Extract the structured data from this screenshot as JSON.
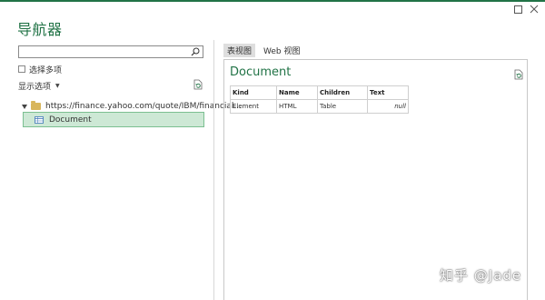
{
  "window": {
    "title": "导航器"
  },
  "left_panel": {
    "search": {
      "placeholder": "",
      "value": ""
    },
    "select_multiple_label": "选择多项",
    "display_options_label": "显示选项",
    "tree": {
      "root_url": "https://finance.yahoo.com/quote/IBM/financial...",
      "selected_item": "Document"
    }
  },
  "tabs": [
    {
      "label": "表视图",
      "active": true
    },
    {
      "label": "Web 视图",
      "active": false
    }
  ],
  "preview": {
    "title": "Document",
    "columns": [
      "Kind",
      "Name",
      "Children",
      "Text"
    ],
    "rows": [
      [
        "Element",
        "HTML",
        "Table",
        "null"
      ]
    ]
  },
  "watermark": "知乎 @Jade",
  "colors": {
    "accent": "#217346",
    "selection_bg": "#cde8d5"
  },
  "icons": [
    "maximize-icon",
    "close-icon",
    "search-icon",
    "checkbox-icon",
    "chevron-down-icon",
    "refresh-icon",
    "expand-arrow-icon",
    "folder-icon",
    "table-icon"
  ]
}
